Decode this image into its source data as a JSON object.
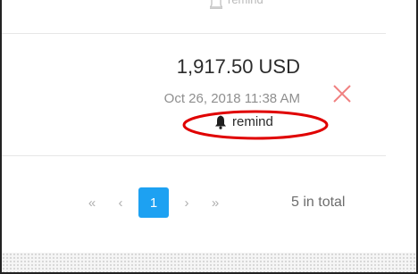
{
  "previous_item": {
    "remind_label": "remind"
  },
  "item": {
    "amount": "1,917.50 USD",
    "datetime": "Oct 26, 2018 11:38 AM",
    "remind_label": "remind",
    "delete_icon": "close-x-icon",
    "remind_icon": "bell-icon"
  },
  "pagination": {
    "first": "«",
    "prev": "‹",
    "current_page": "1",
    "next": "›",
    "last": "»",
    "total_text": "5 in total"
  },
  "colors": {
    "accent": "#1da1f2",
    "delete": "#f08080",
    "annotation": "#e00000"
  }
}
